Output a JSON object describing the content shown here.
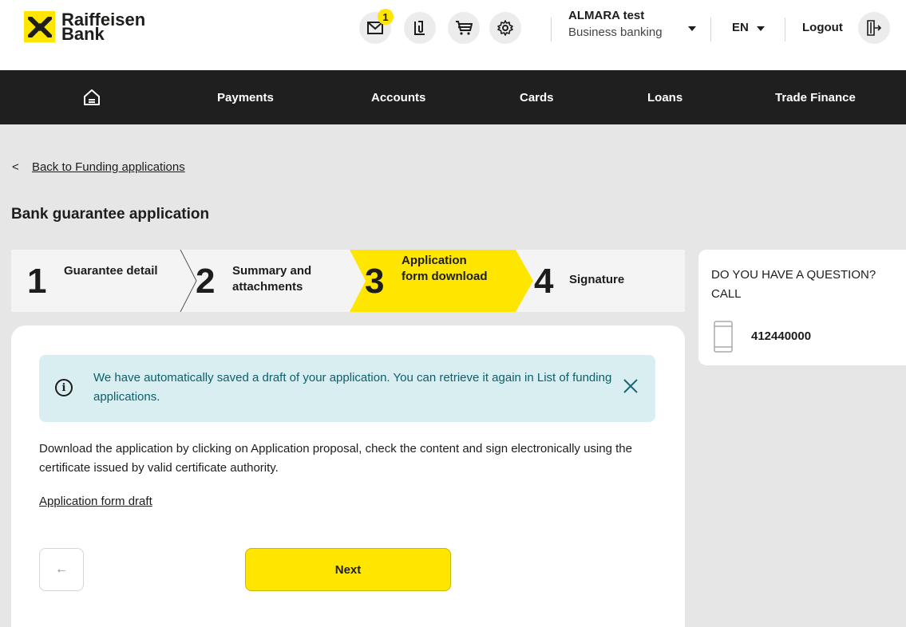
{
  "brand": {
    "line1": "Raiffeisen",
    "line2": "Bank",
    "yellow": "#fee600"
  },
  "header": {
    "icons": [
      "mail-icon",
      "attachment-icon",
      "cart-icon",
      "settings-icon"
    ],
    "mail_badge": "1",
    "user_name": "ALMARA test",
    "user_sub": "Business banking",
    "language": "EN",
    "logout": "Logout"
  },
  "nav": {
    "home_icon": "home-icon",
    "items": [
      "Payments",
      "Accounts",
      "Cards",
      "Loans",
      "Trade Finance"
    ]
  },
  "breadcrumb": {
    "chevron": "<",
    "label": "Back to Funding applications"
  },
  "page_title": "Bank guarantee application",
  "steps": [
    {
      "num": "1",
      "label": "Guarantee detail"
    },
    {
      "num": "2",
      "label": "Summary and attachments"
    },
    {
      "num": "3",
      "label": "Application form download",
      "active": true
    },
    {
      "num": "4",
      "label": "Signature"
    }
  ],
  "help": {
    "title": "DO YOU HAVE A QUESTION? CALL",
    "phone": "412440000"
  },
  "info": {
    "icon": "i",
    "text": "We have automatically saved a draft of your application. You can retrieve it again in  List of funding applications."
  },
  "description": "Download the application by clicking on Application proposal, check the content and sign electronically using the certificate issued by valid certificate authority.",
  "draft_link": "Application form draft",
  "buttons": {
    "back": "←",
    "next": "Next"
  }
}
